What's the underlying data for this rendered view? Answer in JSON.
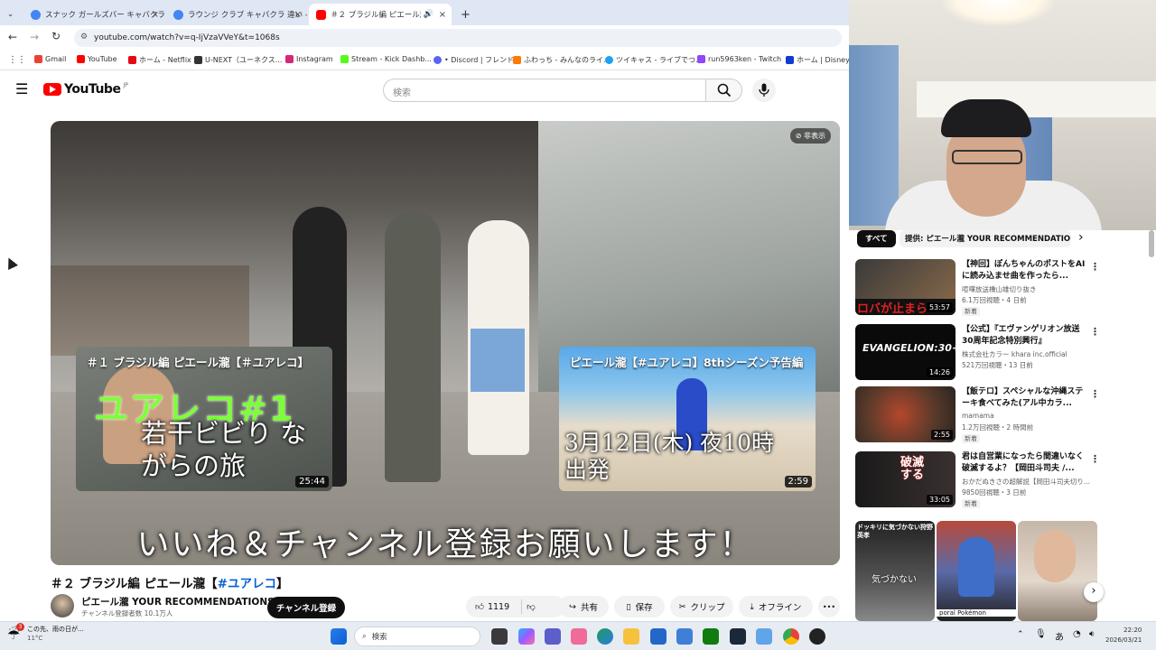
{
  "tabs": [
    {
      "title": "スナック ガールズバー キャバクラ 違い",
      "close": "×"
    },
    {
      "title": "ラウンジ クラブ キャバクラ 違い - Go",
      "close": "×"
    },
    {
      "title": "＃２ ブラジル編 ピエール瀧【＃",
      "close": "×",
      "active": true
    }
  ],
  "new_tab": "+",
  "url": "youtube.com/watch?v=q-IjVzaVVeY&t=1068s",
  "bookmarks": [
    "Gmail",
    "YouTube",
    "ホーム - Netflix",
    "U-NEXT（ユーネクス...",
    "Instagram",
    "Stream - Kick Dashb...",
    "• Discord | フレンド",
    "ふわっち - みんなのライ...",
    "ツイキャス - ライブでつ...",
    "run5963ken - Twitch",
    "ホーム | Disney+"
  ],
  "yt": {
    "logo": "YouTube",
    "region": "JP",
    "search_placeholder": "検索"
  },
  "video": {
    "hide_label": "非表示",
    "endcard_left": {
      "title": "＃１ ブラジル編 ピエール瀧【＃ユアレコ】",
      "duration": "25:44",
      "overlay": "若干ビビり ながらの旅",
      "overlay_top": "ユアレコ#1"
    },
    "endcard_right": {
      "title": "ピエール瀧【#ユアレコ】8thシーズン予告編",
      "duration": "2:59",
      "overlay": "3月12日(木) 夜10時出発"
    },
    "promo": "いいね＆チャンネル登録お願いします！"
  },
  "title_prefix": "＃２ ブラジル編 ピエール瀧【",
  "title_tag": "#ユアレコ",
  "title_suffix": "】",
  "channel": {
    "name": "ピエール瀧 YOUR RECOMMENDATIONS",
    "subs": "チャンネル登録者数 10.1万人",
    "subscribe": "チャンネル登録"
  },
  "actions": {
    "likes": "1119",
    "share": "共有",
    "save": "保存",
    "clip": "クリップ",
    "offline": "オフライン",
    "more": "•••"
  },
  "chips": {
    "all": "すべて",
    "provided": "提供: ピエール瀧 YOUR RECOMMENDATIO"
  },
  "recs": [
    {
      "title": "【神回】ぽんちゃんのポストをAIに読み込ませ曲を作ったら...",
      "channel": "喧嘩放送橋山雄切り抜き",
      "views": "6.1万回視聴・4 日前",
      "badge": "新着",
      "duration": "53:57",
      "thumb_text": "ロバが止まら"
    },
    {
      "title": "【公式】『エヴァンゲリオン放送30周年記念特別興行』",
      "channel": "株式会社カラー khara inc.official",
      "views": "521万回視聴・13 日前",
      "badge": "",
      "duration": "14:26",
      "thumb_text": "EVANGELION:30+"
    },
    {
      "title": "【飯テロ】スペシャルな沖縄ステーキ食べてみた(アル中カラ...",
      "channel": "mamama",
      "views": "1.2万回視聴・2 時間前",
      "badge": "新着",
      "duration": "2:55",
      "thumb_text": ""
    },
    {
      "title": "君は自営業になったら間違いなく破滅するよ？【岡田斗司夫 /...",
      "channel": "おかだぬきさの超解説【岡田斗司夫切り...",
      "views": "9850回視聴・3 日前",
      "badge": "新着",
      "duration": "33:05",
      "thumb_text": "破滅する"
    }
  ],
  "shorts": [
    {
      "text": "ドッキリに気づかない狩野英孝"
    },
    {
      "text": "poral Pokémon"
    },
    {
      "text": ""
    }
  ],
  "shorts_overlay": "気づかない",
  "weather": {
    "line1": "この先、雨の日が...",
    "line2": "11°C",
    "badge": "3"
  },
  "taskbar_search": "検索",
  "clock": {
    "time": "22:20",
    "date": "2026/03/21"
  },
  "ime": "あ",
  "colors": {
    "yt_red": "#ff0000",
    "link_blue": "#065fd4",
    "subscribe_bg": "#0f0f0f"
  }
}
